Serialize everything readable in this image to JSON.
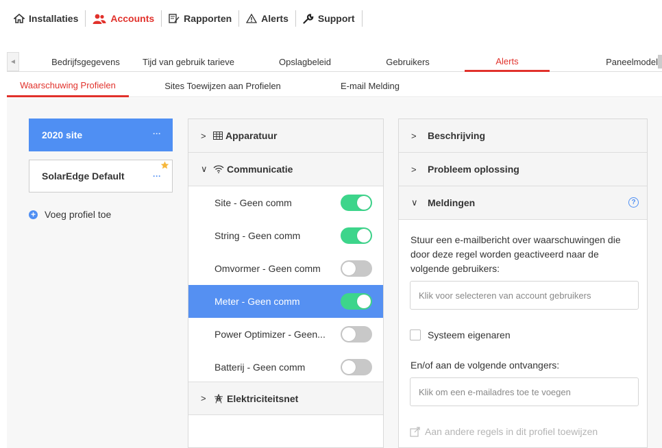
{
  "topnav": {
    "items": [
      {
        "label": "Installaties",
        "icon": "home-icon",
        "active": false
      },
      {
        "label": "Accounts",
        "icon": "users-icon",
        "active": true
      },
      {
        "label": "Rapporten",
        "icon": "report-edit-icon",
        "active": false
      },
      {
        "label": "Alerts",
        "icon": "warning-triangle-icon",
        "active": false
      },
      {
        "label": "Support",
        "icon": "wrench-icon",
        "active": false
      }
    ]
  },
  "settings_tabs": {
    "items": [
      "Bedrijfsgegevens",
      "Tijd van gebruik tarieve",
      "Opslagbeleid",
      "Gebruikers",
      "Alerts",
      "Paneelmodel"
    ],
    "active": "Alerts"
  },
  "sub_tabs": {
    "items": [
      "Waarschuwing Profielen",
      "Sites Toewijzen aan Profielen",
      "E-mail Melding"
    ],
    "active": "Waarschuwing Profielen"
  },
  "profiles": {
    "items": [
      {
        "name": "2020 site",
        "selected": true,
        "default_star": false,
        "menu": "···"
      },
      {
        "name": "SolarEdge Default",
        "selected": false,
        "default_star": true,
        "menu": "···"
      }
    ],
    "add_label": "Voeg profiel toe"
  },
  "categories": {
    "apparatuur": {
      "label": "Apparatuur",
      "expanded": false,
      "icon": "grid-icon"
    },
    "communicatie": {
      "label": "Communicatie",
      "expanded": true,
      "icon": "wifi-icon",
      "alerts": [
        {
          "label": "Site - Geen comm",
          "enabled": true,
          "selected": false
        },
        {
          "label": "String - Geen comm",
          "enabled": true,
          "selected": false
        },
        {
          "label": "Omvormer - Geen comm",
          "enabled": false,
          "selected": false
        },
        {
          "label": "Meter - Geen comm",
          "enabled": true,
          "selected": true
        },
        {
          "label": "Power Optimizer - Geen...",
          "enabled": false,
          "selected": false
        },
        {
          "label": "Batterij - Geen comm",
          "enabled": false,
          "selected": false
        }
      ]
    },
    "elektriciteitsnet": {
      "label": "Elektriciteitsnet",
      "expanded": false,
      "icon": "power-tower-icon"
    }
  },
  "details": {
    "beschrijving": "Beschrijving",
    "probleem": "Probleem oplossing",
    "meldingen": "Meldingen",
    "description": "Stuur een e-mailbericht over waarschuwingen die door deze regel worden geactiveerd naar de volgende gebruikers:",
    "users_placeholder": "Klik voor selecteren van account gebruikers",
    "system_owners_label": "Systeem eigenaren",
    "system_owners_checked": false,
    "recipients_label": "En/of aan de volgende ontvangers:",
    "email_placeholder": "Klik om een e-mailadres toe te voegen",
    "assign_label": "Aan andere regels in dit profiel toewijzen"
  },
  "colors": {
    "accent_red": "#e1312b",
    "selection_blue": "#4f8ff3",
    "toggle_on": "#3dd58b",
    "toggle_off": "#c8c8c8"
  }
}
